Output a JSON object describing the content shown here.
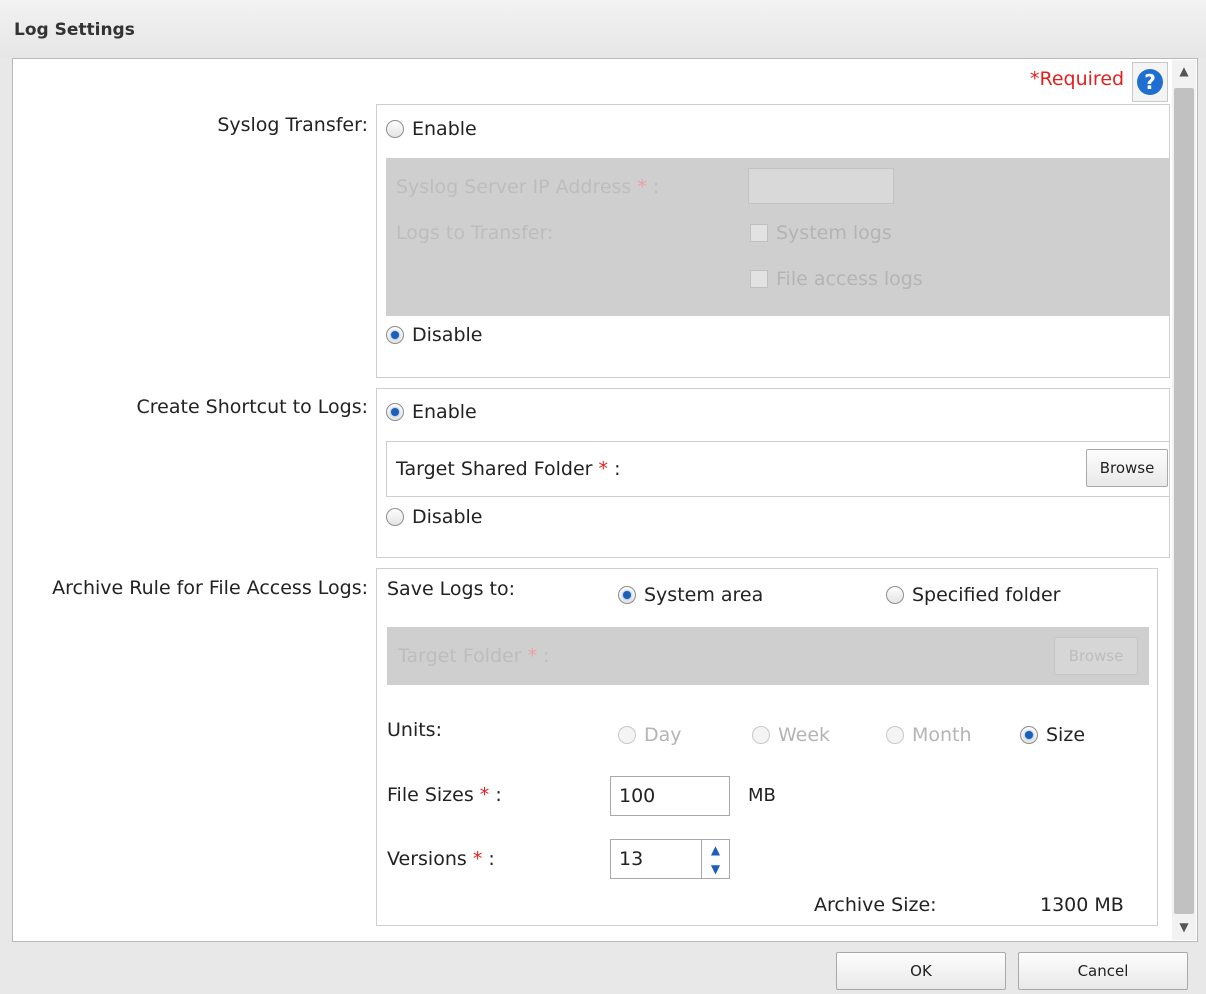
{
  "window": {
    "title": "Log Settings"
  },
  "required_note": "*Required",
  "help_icon": "?",
  "asterisk": "*",
  "syslog": {
    "label": "Syslog Transfer:",
    "enable_label": "Enable",
    "disable_label": "Disable",
    "selected": "Disable",
    "server_ip_label": "Syslog Server IP Address",
    "logs_label": "Logs to Transfer:",
    "system_logs": "System logs",
    "file_access_logs": "File access logs"
  },
  "shortcut": {
    "label": "Create Shortcut to Logs:",
    "enable_label": "Enable",
    "disable_label": "Disable",
    "selected": "Enable",
    "target_label": "Target Shared Folder",
    "browse_label": "Browse"
  },
  "archive": {
    "label": "Archive Rule for File Access Logs:",
    "save_label": "Save Logs to:",
    "system_area": "System area",
    "specified_folder": "Specified folder",
    "save_selected": "System area",
    "target_folder_label": "Target Folder",
    "browse_label": "Browse",
    "units_label": "Units:",
    "unit_day": "Day",
    "unit_week": "Week",
    "unit_month": "Month",
    "unit_size": "Size",
    "unit_selected": "Size",
    "file_sizes_label": "File Sizes",
    "file_size_value": "100",
    "file_size_unit": "MB",
    "versions_label": "Versions",
    "versions_value": "13",
    "archive_size_label": "Archive Size:",
    "archive_size_value": "1300 MB"
  },
  "footer": {
    "ok_label": "OK",
    "cancel_label": "Cancel"
  },
  "colors": {
    "accent": "#1d5fb8",
    "required": "#e32020",
    "disabled_bg": "#cfcfcf"
  }
}
